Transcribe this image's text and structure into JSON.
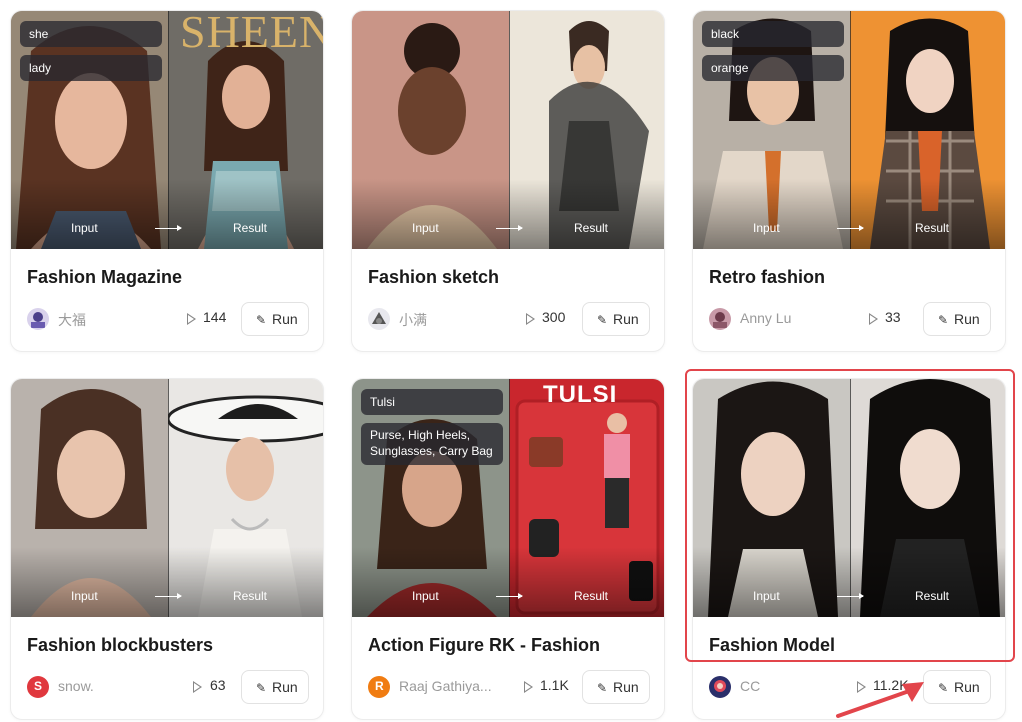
{
  "cards": [
    {
      "title": "Fashion Magazine",
      "author": "大福",
      "runs": "144",
      "run_label": "Run",
      "input_label": "Input",
      "result_label": "Result",
      "tags": [
        "she",
        "lady"
      ],
      "overlay_text": "SHEEN"
    },
    {
      "title": "Fashion sketch",
      "author": "小满",
      "runs": "300",
      "run_label": "Run",
      "input_label": "Input",
      "result_label": "Result",
      "tags": []
    },
    {
      "title": "Retro fashion",
      "author": "Anny Lu",
      "runs": "33",
      "run_label": "Run",
      "input_label": "Input",
      "result_label": "Result",
      "tags": [
        "black",
        "orange"
      ]
    },
    {
      "title": "Fashion blockbusters",
      "author": "snow.",
      "avatar_letter": "S",
      "runs": "63",
      "run_label": "Run",
      "input_label": "Input",
      "result_label": "Result",
      "tags": []
    },
    {
      "title": "Action Figure RK - Fashion",
      "author": "Raaj Gathiya...",
      "avatar_letter": "R",
      "runs": "1.1K",
      "run_label": "Run",
      "input_label": "Input",
      "result_label": "Result",
      "tags": [
        "Tulsi",
        "Purse, High Heels,",
        "Sunglasses, Carry Bag"
      ],
      "overlay_text": "TULSI"
    },
    {
      "title": "Fashion Model",
      "author": "CC",
      "runs": "11.2K",
      "run_label": "Run",
      "input_label": "Input",
      "result_label": "Result",
      "tags": []
    }
  ],
  "colors": {
    "highlight": "#e2454b",
    "annotation_arrow": "#e2454b",
    "avatar_snow": "#e0383e",
    "avatar_raaj": "#f07c12"
  },
  "icons": [
    "play-icon",
    "magic-wand-icon",
    "arrow-right-icon"
  ]
}
